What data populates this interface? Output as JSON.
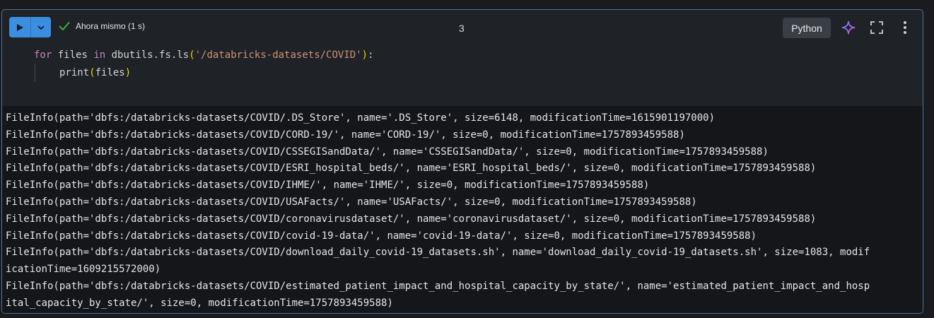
{
  "header": {
    "status_text": "Ahora mismo (1 s)",
    "cell_number": "3",
    "language": "Python",
    "icons": {
      "run": "play-icon",
      "dropdown": "chevron-down-icon",
      "status": "check-icon",
      "assistant": "sparkle-icon",
      "expand": "expand-icon",
      "more": "more-vertical-icon"
    },
    "colors": {
      "run_button": "#3c8ee0",
      "check": "#3fb950",
      "sparkle_start": "#4f8cff",
      "sparkle_end": "#e84ccf",
      "cell_border": "#4d7596"
    }
  },
  "code": {
    "line1": {
      "kw1": "for",
      "t1": " files ",
      "kw2": "in",
      "t2": " dbutils.fs.ls",
      "p1": "(",
      "s1": "'/databricks-datasets/COVID'",
      "p2": ")",
      "t3": ":"
    },
    "line2": {
      "t1": "print",
      "p1": "(",
      "t2": "files",
      "p2": ")"
    }
  },
  "output": {
    "lines": [
      "FileInfo(path='dbfs:/databricks-datasets/COVID/.DS_Store', name='.DS_Store', size=6148, modificationTime=1615901197000)",
      "FileInfo(path='dbfs:/databricks-datasets/COVID/CORD-19/', name='CORD-19/', size=0, modificationTime=1757893459588)",
      "FileInfo(path='dbfs:/databricks-datasets/COVID/CSSEGISandData/', name='CSSEGISandData/', size=0, modificationTime=1757893459588)",
      "FileInfo(path='dbfs:/databricks-datasets/COVID/ESRI_hospital_beds/', name='ESRI_hospital_beds/', size=0, modificationTime=1757893459588)",
      "FileInfo(path='dbfs:/databricks-datasets/COVID/IHME/', name='IHME/', size=0, modificationTime=1757893459588)",
      "FileInfo(path='dbfs:/databricks-datasets/COVID/USAFacts/', name='USAFacts/', size=0, modificationTime=1757893459588)",
      "FileInfo(path='dbfs:/databricks-datasets/COVID/coronavirusdataset/', name='coronavirusdataset/', size=0, modificationTime=1757893459588)",
      "FileInfo(path='dbfs:/databricks-datasets/COVID/covid-19-data/', name='covid-19-data/', size=0, modificationTime=1757893459588)",
      "FileInfo(path='dbfs:/databricks-datasets/COVID/download_daily_covid-19_datasets.sh', name='download_daily_covid-19_datasets.sh', size=1083, modif",
      "icationTime=1609215572000)",
      "FileInfo(path='dbfs:/databricks-datasets/COVID/estimated_patient_impact_and_hospital_capacity_by_state/', name='estimated_patient_impact_and_hosp",
      "ital_capacity_by_state/', size=0, modificationTime=1757893459588)"
    ]
  }
}
